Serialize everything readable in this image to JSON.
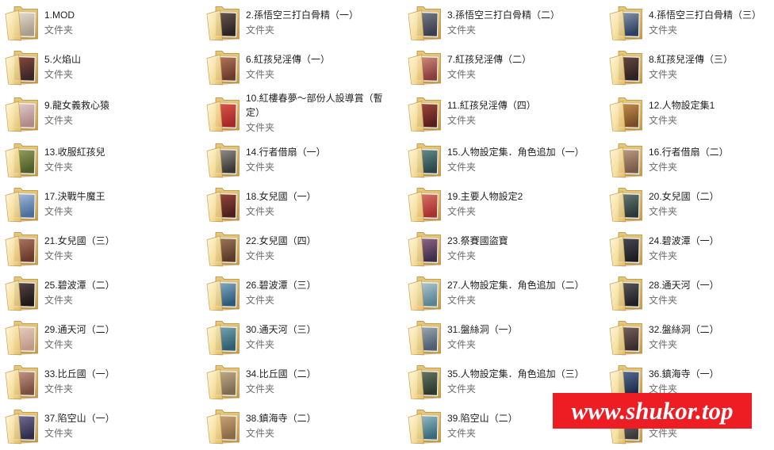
{
  "items": [
    {
      "name": "1.MOD",
      "type": "文件夹",
      "thumb": [
        "#a89d8a",
        "#e6e0d2"
      ]
    },
    {
      "name": "2.孫悟空三打白骨精（一）",
      "type": "文件夹",
      "thumb": [
        "#2b2424",
        "#6b5a50"
      ]
    },
    {
      "name": "3.孫悟空三打白骨精（二）",
      "type": "文件夹",
      "thumb": [
        "#3c3f4d",
        "#7a7f8c"
      ]
    },
    {
      "name": "4.孫悟空三打白骨精（三）",
      "type": "文件夹",
      "thumb": [
        "#2e4060",
        "#8a9ab0"
      ]
    },
    {
      "name": "5.火焰山",
      "type": "文件夹",
      "thumb": [
        "#3a2626",
        "#8c4b3c"
      ]
    },
    {
      "name": "6.紅孩兒淫傳（一）",
      "type": "文件夹",
      "thumb": [
        "#6e3a2e",
        "#b57a5e"
      ]
    },
    {
      "name": "7.紅孩兒淫傳（二）",
      "type": "文件夹",
      "thumb": [
        "#8a3c3c",
        "#d09080"
      ]
    },
    {
      "name": "8.紅孩兒淫傳（三）",
      "type": "文件夹",
      "thumb": [
        "#2e2222",
        "#6a4a40"
      ]
    },
    {
      "name": "9.龍女義救心猿",
      "type": "文件夹",
      "thumb": [
        "#b08888",
        "#e4cfcf"
      ]
    },
    {
      "name": "10.紅樓春夢～部份人設導賞（暫定）",
      "type": "文件夹",
      "thumb": [
        "#a82828",
        "#d85a4a"
      ]
    },
    {
      "name": "11.紅孩兒淫傳（四）",
      "type": "文件夹",
      "thumb": [
        "#5a1e1e",
        "#a04a3a"
      ]
    },
    {
      "name": "12.人物設定集1",
      "type": "文件夹",
      "thumb": [
        "#7a4e26",
        "#c89050"
      ]
    },
    {
      "name": "13.收服紅孩兒",
      "type": "文件夹",
      "thumb": [
        "#4e5e2a",
        "#9aa060"
      ]
    },
    {
      "name": "14.行者借扇（一）",
      "type": "文件夹",
      "thumb": [
        "#3a3838",
        "#9a9490"
      ]
    },
    {
      "name": "15.人物設定集．角色追加（一）",
      "type": "文件夹",
      "thumb": [
        "#2a4848",
        "#6a9090"
      ]
    },
    {
      "name": "16.行者借扇（二）",
      "type": "文件夹",
      "thumb": [
        "#7a5a4a",
        "#c0a088"
      ]
    },
    {
      "name": "17.決戰牛魔王",
      "type": "文件夹",
      "thumb": [
        "#4a6e9e",
        "#a8c0dc"
      ]
    },
    {
      "name": "18.女兒國（一）",
      "type": "文件夹",
      "thumb": [
        "#4e1e1e",
        "#9a4a3a"
      ]
    },
    {
      "name": "19.主要人物設定2",
      "type": "文件夹",
      "thumb": [
        "#a83030",
        "#d8786a"
      ]
    },
    {
      "name": "20.女兒國（二）",
      "type": "文件夹",
      "thumb": [
        "#2a3a3a",
        "#6a7e7a"
      ]
    },
    {
      "name": "21.女兒國（三）",
      "type": "文件夹",
      "thumb": [
        "#6a3a2e",
        "#b07a62"
      ]
    },
    {
      "name": "22.女兒國（四）",
      "type": "文件夹",
      "thumb": [
        "#5a3a2a",
        "#a07a5a"
      ]
    },
    {
      "name": "23.祭賽國盜寶",
      "type": "文件夹",
      "thumb": [
        "#3e2e4a",
        "#9a6a8a"
      ]
    },
    {
      "name": "24.碧波潭（一）",
      "type": "文件夹",
      "thumb": [
        "#1e1e24",
        "#4a4a58"
      ]
    },
    {
      "name": "25.碧波潭（二）",
      "type": "文件夹",
      "thumb": [
        "#1e1818",
        "#5a4a48"
      ]
    },
    {
      "name": "26.碧波潭（三）",
      "type": "文件夹",
      "thumb": [
        "#2e5a7a",
        "#8ab0c8"
      ]
    },
    {
      "name": "27.人物設定集．角色追加（二）",
      "type": "文件夹",
      "thumb": [
        "#5a8494",
        "#b0ccd6"
      ]
    },
    {
      "name": "28.通天河（一）",
      "type": "文件夹",
      "thumb": [
        "#222226",
        "#5a5a60"
      ]
    },
    {
      "name": "29.通天河（二）",
      "type": "文件夹",
      "thumb": [
        "#c09a88",
        "#e8d0c4"
      ]
    },
    {
      "name": "30.通天河（三）",
      "type": "文件夹",
      "thumb": [
        "#2e5e70",
        "#7aa8b8"
      ]
    },
    {
      "name": "31.盤絲洞（一）",
      "type": "文件夹",
      "thumb": [
        "#4e5e70",
        "#a0acb8"
      ]
    },
    {
      "name": "32.盤絲洞（二）",
      "type": "文件夹",
      "thumb": [
        "#3a2e2c",
        "#7a6460"
      ]
    },
    {
      "name": "33.比丘國（一）",
      "type": "文件夹",
      "thumb": [
        "#7a4e40",
        "#c89a88"
      ]
    },
    {
      "name": "34.比丘國（二）",
      "type": "文件夹",
      "thumb": [
        "#7e6c50",
        "#c4b08c"
      ]
    },
    {
      "name": "35.人物設定集．角色追加（三）",
      "type": "文件夹",
      "thumb": [
        "#2e3a30",
        "#6a7a68"
      ]
    },
    {
      "name": "36.鎮海寺（一）",
      "type": "文件夹",
      "thumb": [
        "#1e2e4e",
        "#5a7098"
      ]
    },
    {
      "name": "37.陷空山（一）",
      "type": "文件夹",
      "thumb": [
        "#2e2e4a",
        "#7a7098"
      ]
    },
    {
      "name": "38.鎮海寺（二）",
      "type": "文件夹",
      "thumb": [
        "#8a6a48",
        "#d0a878"
      ]
    },
    {
      "name": "39.陷空山（二）",
      "type": "文件夹",
      "thumb": [
        "#3a6a7a",
        "#9ac0cc"
      ]
    },
    {
      "type": "文件夹",
      "thumb": [
        "#3a3a3a",
        "#7a7a7a"
      ]
    }
  ],
  "watermark": {
    "text": "www.shukor.top",
    "bg": "#ee1d24",
    "fg": "#ffffff"
  }
}
